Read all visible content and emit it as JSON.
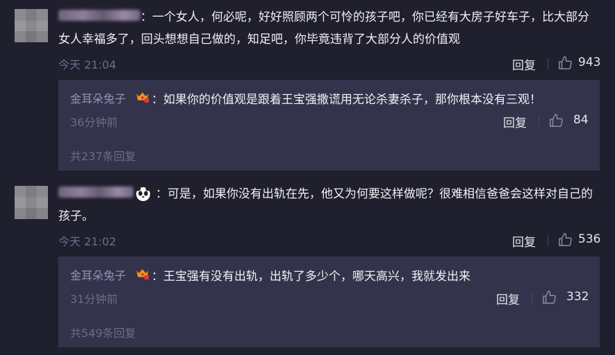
{
  "comments": [
    {
      "text": "：一个女人，何必呢，好好照顾两个可怜的孩子吧，你已经有大房子好车子，比大部分女人幸福多了，回头想想自己做的，知足吧，你毕竟违背了大部分人的价值观",
      "time": "今天 21:04",
      "reply_label": "回复",
      "likes": "943",
      "reply": {
        "name": "金耳朵兔子",
        "text": "：如果你的价值观是跟着王宝强撒谎用无论杀妻杀子，那你根本没有三观！",
        "time": "36分钟前",
        "reply_label": "回复",
        "likes": "84",
        "total": "共237条回复"
      }
    },
    {
      "text": "：可是，如果你没有出轨在先，他又为何要这样做呢？很难相信爸爸会这样对自己的孩子。",
      "time": "今天 21:02",
      "reply_label": "回复",
      "likes": "536",
      "reply": {
        "name": "金耳朵兔子",
        "text": "：王宝强有没有出轨，出轨了多少个，哪天高兴，我就发出来",
        "time": "31分钟前",
        "reply_label": "回复",
        "likes": "332",
        "total": "共549条回复"
      }
    }
  ],
  "icons": {
    "like": "thumbs-up-icon",
    "badge": "crown-badge-icon",
    "panda": "panda-emoji-icon"
  },
  "colors": {
    "background": "#1f1f2d",
    "reply_box": "#33334b",
    "username": "#9790b8",
    "meta": "#6b6d8a"
  }
}
